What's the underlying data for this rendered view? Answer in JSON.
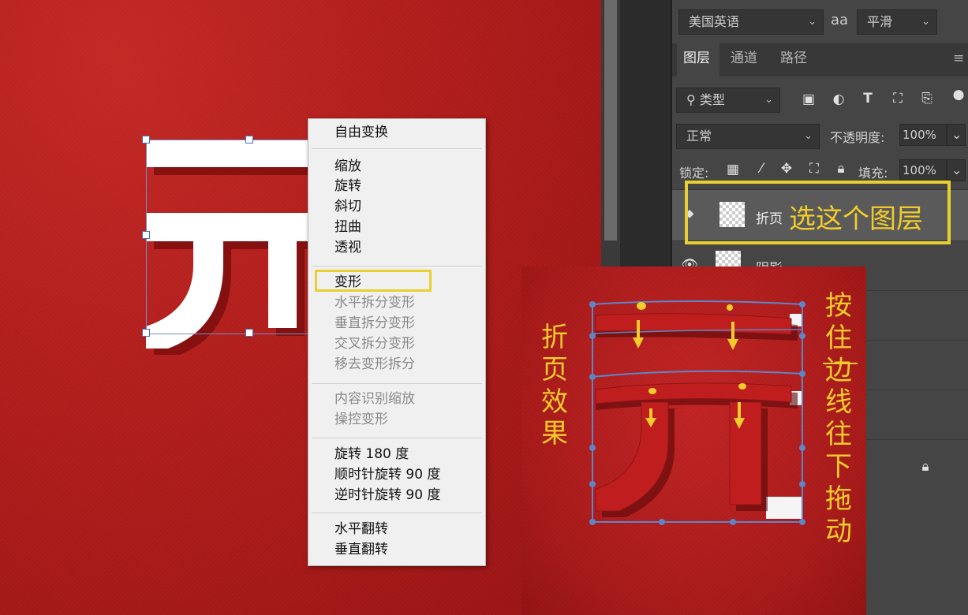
{
  "options_bar": {
    "language": "美国英语",
    "aa_label": "aa",
    "antialias": "平滑"
  },
  "layers_panel": {
    "tabs": [
      "图层",
      "通道",
      "路径"
    ],
    "filter_label": "类型",
    "blend_mode": "正常",
    "opacity_label": "不透明度:",
    "opacity_value": "100%",
    "lock_label": "锁定:",
    "fill_label": "填充:",
    "fill_value": "100%",
    "layers": [
      {
        "name": "折页",
        "selected": true
      },
      {
        "name": "阴影",
        "selected": false
      }
    ]
  },
  "canvas": {
    "glyph": "元"
  },
  "context_menu": {
    "groups": [
      [
        {
          "label": "自由变换",
          "enabled": true
        }
      ],
      [
        {
          "label": "缩放",
          "enabled": true
        },
        {
          "label": "旋转",
          "enabled": true
        },
        {
          "label": "斜切",
          "enabled": true
        },
        {
          "label": "扭曲",
          "enabled": true
        },
        {
          "label": "透视",
          "enabled": true
        }
      ],
      [
        {
          "label": "变形",
          "enabled": true,
          "highlighted": true
        },
        {
          "label": "水平拆分变形",
          "enabled": false
        },
        {
          "label": "垂直拆分变形",
          "enabled": false
        },
        {
          "label": "交叉拆分变形",
          "enabled": false
        },
        {
          "label": "移去变形拆分",
          "enabled": false
        }
      ],
      [
        {
          "label": "内容识别缩放",
          "enabled": false
        },
        {
          "label": "操控变形",
          "enabled": false
        }
      ],
      [
        {
          "label": "旋转 180 度",
          "enabled": true
        },
        {
          "label": "顺时针旋转 90 度",
          "enabled": true
        },
        {
          "label": "逆时针旋转 90 度",
          "enabled": true
        }
      ],
      [
        {
          "label": "水平翻转",
          "enabled": true
        },
        {
          "label": "垂直翻转",
          "enabled": true
        }
      ]
    ]
  },
  "annotations": {
    "select_layer": "选这个图层",
    "fold_effect": "折页效果",
    "drag_hint": "按住边线往下拖动",
    "accent_color": "#f2cc2b"
  },
  "icons": [
    "search-icon",
    "image-filter-icon",
    "adjustment-filter-icon",
    "type-filter-icon",
    "shape-filter-icon",
    "smart-object-filter-icon",
    "lock-pixels-icon",
    "lock-brush-icon",
    "lock-move-icon",
    "lock-artboard-icon",
    "lock-all-icon",
    "visibility-eye-icon",
    "panel-menu-icon",
    "lock-icon"
  ]
}
